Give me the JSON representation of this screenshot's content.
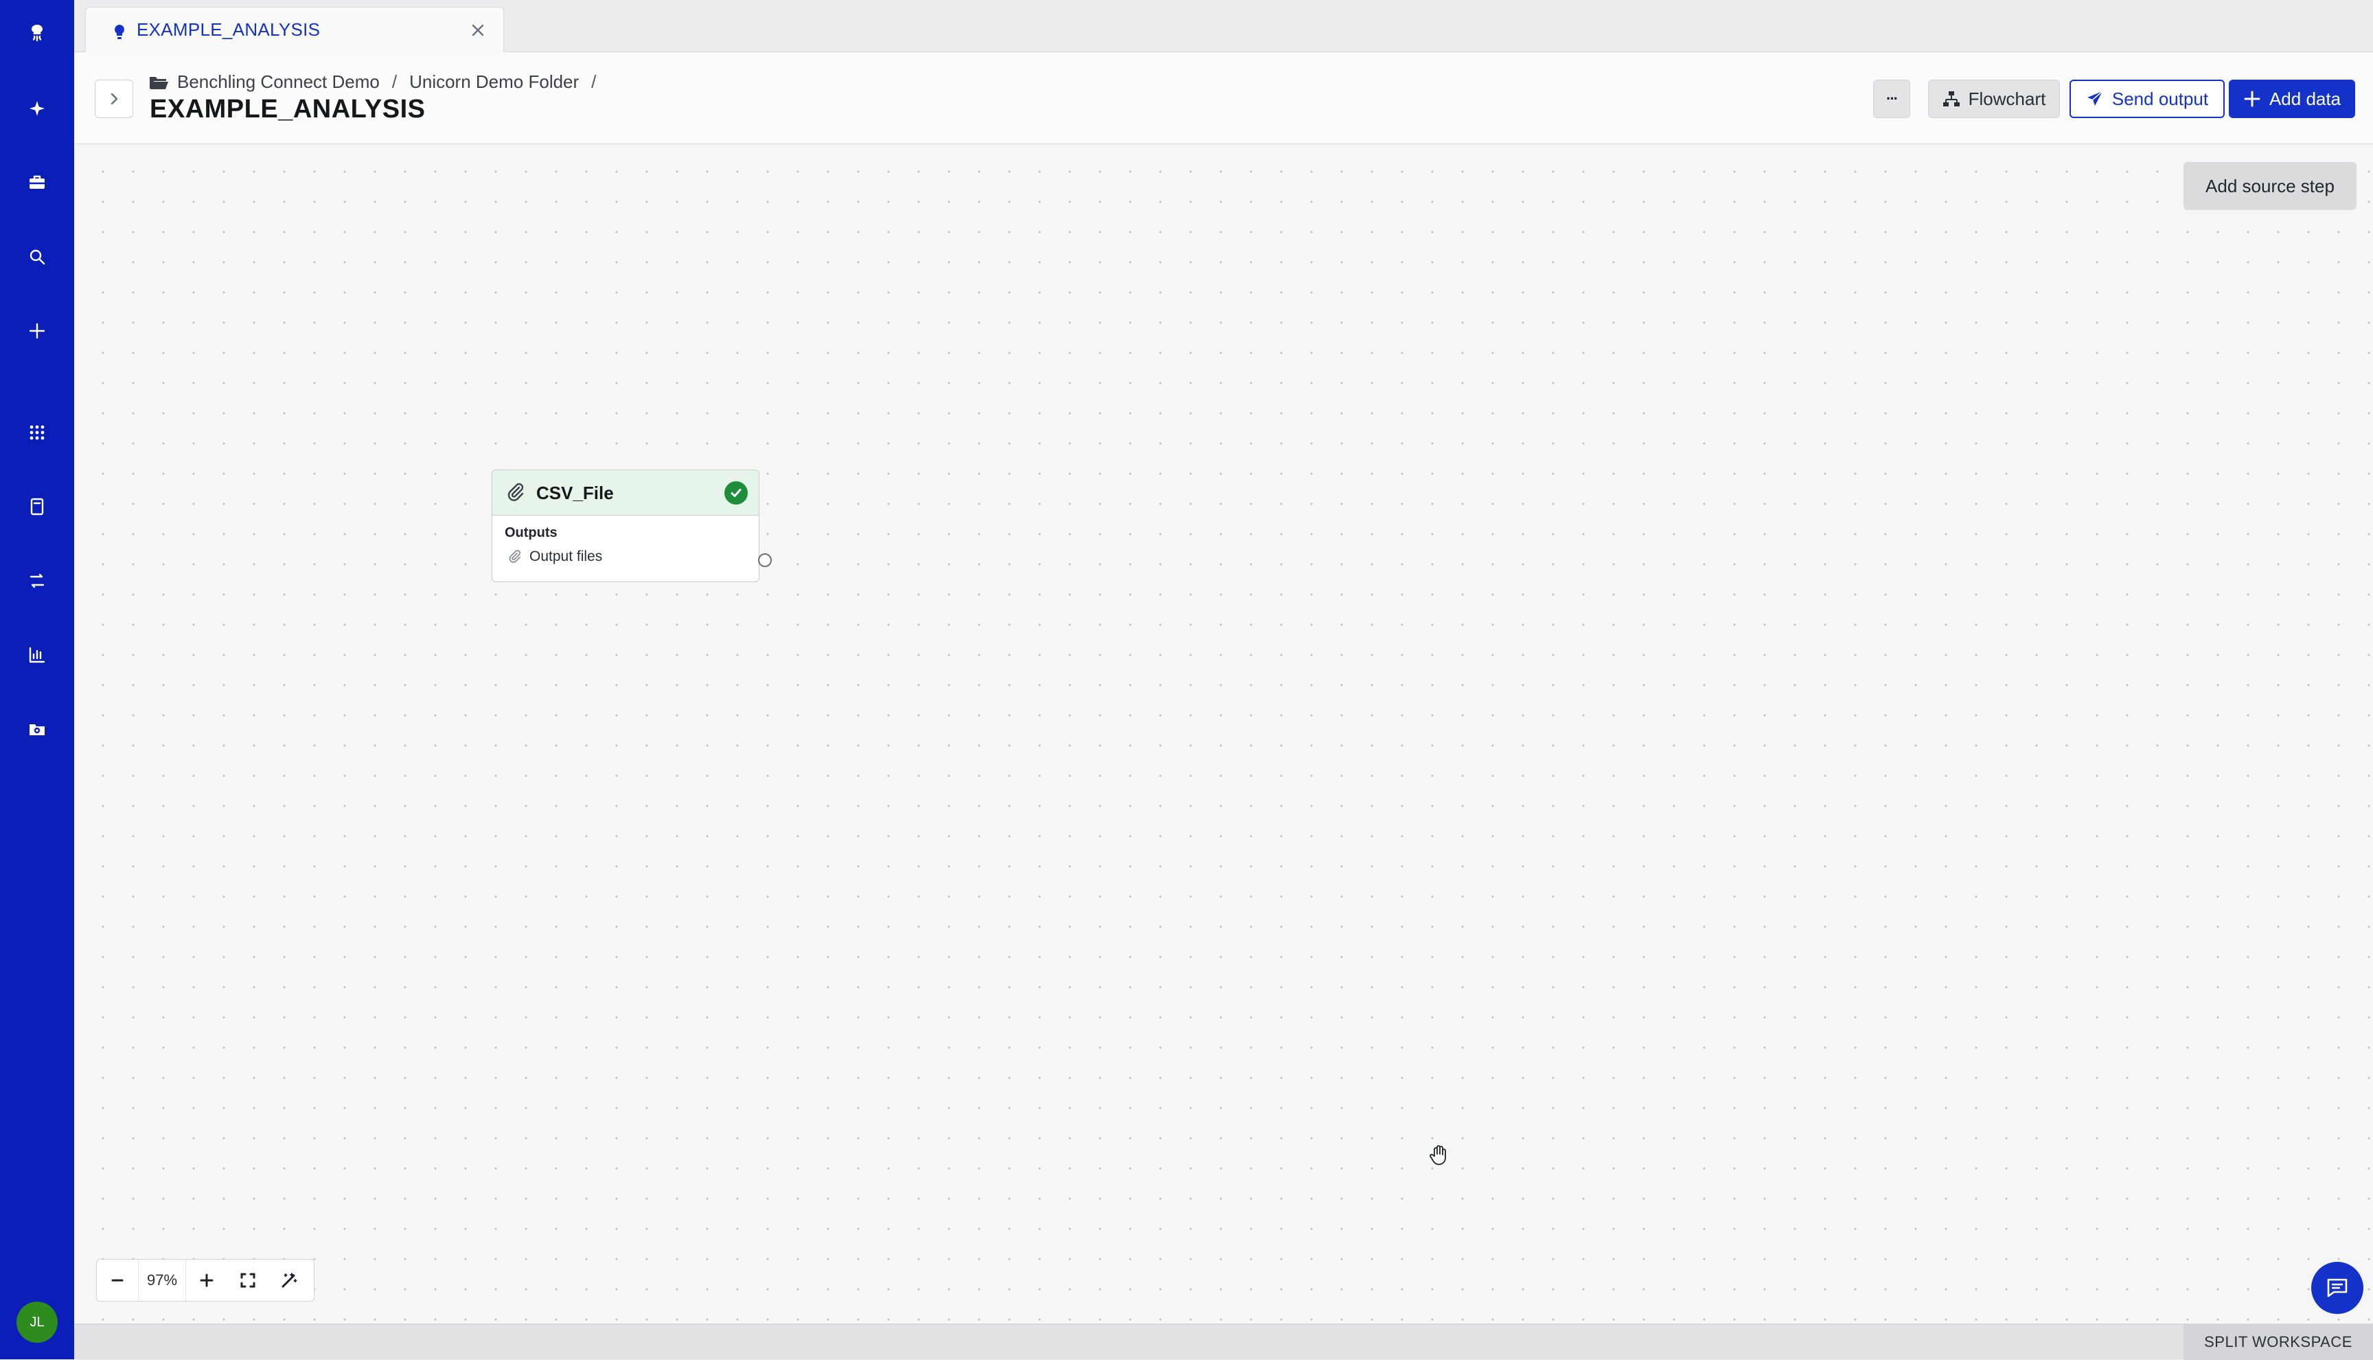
{
  "tab": {
    "label": "EXAMPLE_ANALYSIS"
  },
  "breadcrumb": {
    "items": [
      "Benchling Connect Demo",
      "Unicorn Demo Folder"
    ],
    "separator": "/"
  },
  "page": {
    "title": "EXAMPLE_ANALYSIS"
  },
  "toolbar": {
    "more_label": "···",
    "flowchart_label": "Flowchart",
    "send_output_label": "Send output",
    "add_data_label": "Add data"
  },
  "canvas": {
    "add_source_label": "Add source step",
    "node": {
      "title": "CSV_File",
      "status": "complete",
      "outputs_label": "Outputs",
      "output_item": "Output files"
    }
  },
  "zoom": {
    "level": "97%"
  },
  "user": {
    "initials": "JL"
  },
  "footer": {
    "split_label": "SPLIT WORKSPACE"
  },
  "colors": {
    "brand": "#1432c8",
    "rail": "#0b1fb8",
    "success": "#1e8d3c",
    "node_header": "#e6f4ea"
  },
  "icons": [
    "logo-icon",
    "sparkle-icon",
    "briefcase-icon",
    "search-icon",
    "plus-icon",
    "apps-grid-icon",
    "notebook-icon",
    "workflow-icon",
    "chart-icon",
    "folder-icon"
  ]
}
